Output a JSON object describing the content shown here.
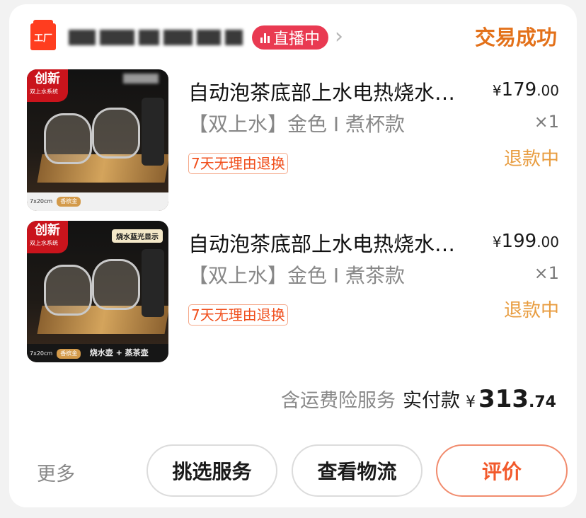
{
  "header": {
    "shop_logo_text": "工厂",
    "live_badge": "直播中",
    "order_status": "交易成功",
    "colors": {
      "status": "#e3711a",
      "live": "#e93a52",
      "logo": "#ff3d1f"
    }
  },
  "items": [
    {
      "title": "自动泡茶底部上水电热烧水…",
      "spec": "【双上水】金色 I 煮杯款",
      "return_tag": "7天无理由退换",
      "price_main": "179",
      "price_decimal": ".00",
      "currency": "¥",
      "qty": "×1",
      "status": "退款中",
      "thumb": {
        "tag": "创新",
        "tag_sub": "双上水系统",
        "foot_size": "7x20cm",
        "foot_color": "香槟金"
      }
    },
    {
      "title": "自动泡茶底部上水电热烧水…",
      "spec": "【双上水】金色 I 煮茶款",
      "return_tag": "7天无理由退换",
      "price_main": "199",
      "price_decimal": ".00",
      "currency": "¥",
      "qty": "×1",
      "status": "退款中",
      "thumb": {
        "tag": "创新",
        "tag_sub": "双上水系统",
        "badge": "烧水蓝光显示",
        "foot_size": "7x20cm",
        "foot_color": "香槟金",
        "foot_caption": "烧水壶 + 蒸茶壶"
      }
    }
  ],
  "summary": {
    "service_text": "含运费险服务",
    "paid_label": "实付款",
    "currency": "¥",
    "total_main": "313",
    "total_decimal": ".74"
  },
  "actions": {
    "more": "更多",
    "select_service": "挑选服务",
    "view_logistics": "查看物流",
    "review": "评价"
  }
}
